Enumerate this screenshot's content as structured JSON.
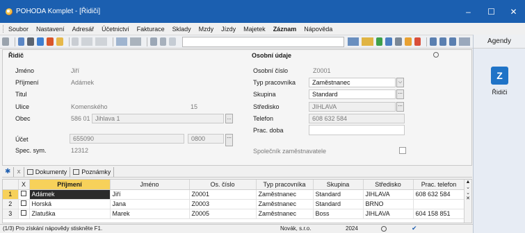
{
  "window": {
    "title": "POHODA Komplet - [Řidiči]",
    "controls": [
      "–",
      "☐",
      "✕"
    ]
  },
  "menu": [
    "Soubor",
    "Nastavení",
    "Adresář",
    "Účetnictví",
    "Fakturace",
    "Sklady",
    "Mzdy",
    "Jízdy",
    "Majetek",
    "Záznam",
    "Nápověda"
  ],
  "agendy": {
    "title": "Agendy",
    "item_label": "Řidiči"
  },
  "ridic": {
    "section_title": "Řidič",
    "labels": {
      "jmeno": "Jméno",
      "prijmeni": "Příjmení",
      "titul": "Titul",
      "ulice": "Ulice",
      "obec": "Obec",
      "ucet": "Účet",
      "spec_sym": "Spec. sym."
    },
    "values": {
      "jmeno": "Jiří",
      "prijmeni": "Adámek",
      "titul": "",
      "ulice": "Komenského",
      "cislo": "15",
      "psc": "586 01",
      "obec": "Jihlava 1",
      "ucet": "655090",
      "banka": "0800",
      "spec_sym": "12312"
    }
  },
  "osobni": {
    "section_title": "Osobní údaje",
    "labels": {
      "osobni_cislo": "Osobní číslo",
      "typ": "Typ pracovníka",
      "skupina": "Skupina",
      "stredisko": "Středisko",
      "telefon": "Telefon",
      "prac_doba": "Prac. doba",
      "spolecnik": "Společník zaměstnavatele"
    },
    "values": {
      "osobni_cislo": "Z0001",
      "typ": "Zaměstnanec",
      "skupina": "Standard",
      "stredisko": "JIHLAVA",
      "telefon": "608 632 584",
      "prac_doba": ""
    }
  },
  "tabs": [
    "Dokumenty",
    "Poznámky"
  ],
  "grid": {
    "columns": [
      "X",
      "Příjmení",
      "Jméno",
      "Os. číslo",
      "Typ pracovníka",
      "Skupina",
      "Středisko",
      "Prac. telefon"
    ],
    "rows": [
      {
        "n": "1",
        "prijmeni": "Adámek",
        "jmeno": "Jiří",
        "cislo": "Z0001",
        "typ": "Zaměstnanec",
        "skupina": "Standard",
        "stredisko": "JIHLAVA",
        "telefon": "608 632 584"
      },
      {
        "n": "2",
        "prijmeni": "Horská",
        "jmeno": "Jana",
        "cislo": "Z0003",
        "typ": "Zaměstnanec",
        "skupina": "Standard",
        "stredisko": "BRNO",
        "telefon": ""
      },
      {
        "n": "3",
        "prijmeni": "Zlatuška",
        "jmeno": "Marek",
        "cislo": "Z0005",
        "typ": "Zaměstnanec",
        "skupina": "Boss",
        "stredisko": "JIHLAVA",
        "telefon": "604 158 851"
      }
    ]
  },
  "status": {
    "hint": "(1/3) Pro získání nápovědy stiskněte F1.",
    "firma": "Novák, s.r.o.",
    "rok": "2024"
  },
  "colors": {
    "titlebar": "#1b5fb0",
    "selection": "#f7d15a",
    "agenda_icon": "#1f73c7"
  }
}
